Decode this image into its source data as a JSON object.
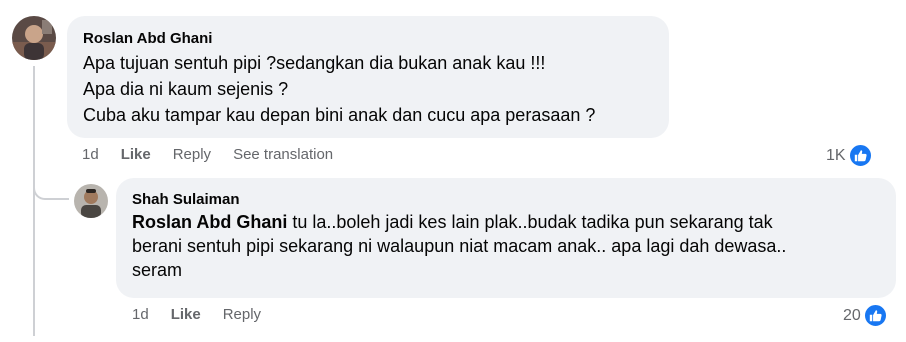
{
  "comment": {
    "author": "Roslan Abd Ghani",
    "lines": [
      "Apa tujuan sentuh pipi ?sedangkan dia bukan anak kau !!!",
      "Apa dia ni kaum sejenis ?",
      "Cuba aku tampar kau depan bini anak dan cucu apa perasaan ?"
    ],
    "time": "1d",
    "like_label": "Like",
    "reply_label": "Reply",
    "translate_label": "See translation",
    "reaction_count": "1K",
    "reaction_icon": "thumbs-up-icon"
  },
  "reply": {
    "author": "Shah Sulaiman",
    "mention": "Roslan Abd Ghani",
    "lines": [
      " tu la..boleh jadi kes lain plak..budak tadika pun sekarang tak",
      "berani sentuh pipi sekarang ni walaupun niat macam anak.. apa lagi dah dewasa..",
      "seram"
    ],
    "time": "1d",
    "like_label": "Like",
    "reply_label": "Reply",
    "reaction_count": "20",
    "reaction_icon": "thumbs-up-icon"
  },
  "colors": {
    "bubble": "#f0f2f5",
    "meta_text": "#65676b",
    "like_blue": "#1877f2",
    "thread_line": "#ced0d4"
  }
}
